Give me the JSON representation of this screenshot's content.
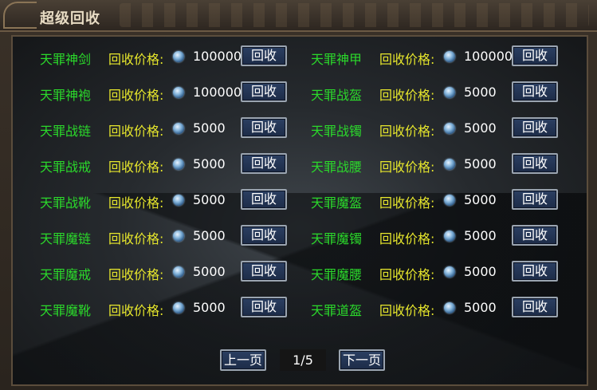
{
  "window": {
    "title": "超级回收"
  },
  "price_label": "回收价格:",
  "button_label": "回收",
  "items_left": [
    {
      "name": "天罪神剑",
      "price": "100000"
    },
    {
      "name": "天罪神袍",
      "price": "100000"
    },
    {
      "name": "天罪战链",
      "price": "5000"
    },
    {
      "name": "天罪战戒",
      "price": "5000"
    },
    {
      "name": "天罪战靴",
      "price": "5000"
    },
    {
      "name": "天罪魔链",
      "price": "5000"
    },
    {
      "name": "天罪魔戒",
      "price": "5000"
    },
    {
      "name": "天罪魔靴",
      "price": "5000"
    }
  ],
  "items_right": [
    {
      "name": "天罪神甲",
      "price": "100000"
    },
    {
      "name": "天罪战盔",
      "price": "5000"
    },
    {
      "name": "天罪战镯",
      "price": "5000"
    },
    {
      "name": "天罪战腰",
      "price": "5000"
    },
    {
      "name": "天罪魔盔",
      "price": "5000"
    },
    {
      "name": "天罪魔镯",
      "price": "5000"
    },
    {
      "name": "天罪魔腰",
      "price": "5000"
    },
    {
      "name": "天罪道盔",
      "price": "5000"
    }
  ],
  "pager": {
    "prev": "上一页",
    "page": "1/5",
    "next": "下一页"
  },
  "colors": {
    "item_name": "#2bd82b",
    "price_label": "#e6e62c",
    "button_bg": "#1d2c48"
  },
  "icons": {
    "currency": "gem-icon"
  }
}
